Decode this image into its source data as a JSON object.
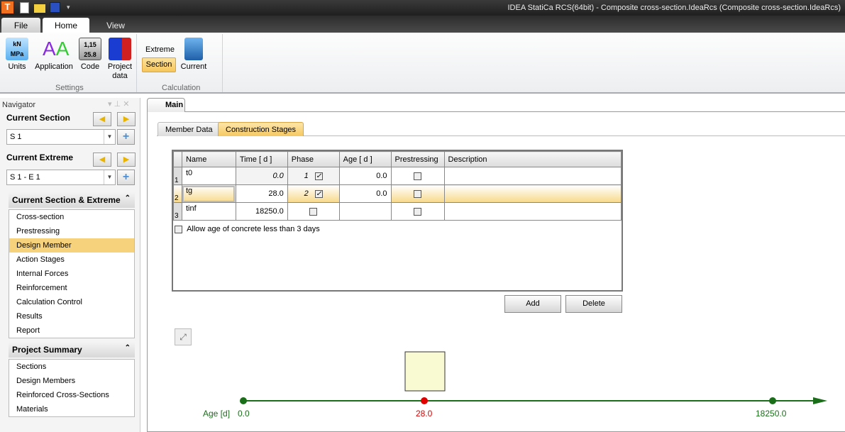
{
  "title": "IDEA StatiCa RCS(64bit) - Composite cross-section.IdeaRcs (Composite cross-section.IdeaRcs)",
  "ribbon_tabs": [
    "File",
    "Home",
    "View"
  ],
  "settings": {
    "group": "Settings",
    "buttons": [
      "Units",
      "Application",
      "Code",
      "Project data"
    ]
  },
  "calculation": {
    "group": "Calculation",
    "extreme": "Extreme",
    "section": "Section",
    "current": "Current"
  },
  "navigator": {
    "title": "Navigator",
    "current_section_label": "Current Section",
    "current_section": "S 1",
    "current_extreme_label": "Current Extreme",
    "current_extreme": "S 1 - E 1",
    "cse_header": "Current Section & Extreme",
    "cse_items": [
      "Cross-section",
      "Prestressing",
      "Design Member",
      "Action Stages",
      "Internal Forces",
      "Reinforcement",
      "Calculation Control",
      "Results",
      "Report"
    ],
    "ps_header": "Project Summary",
    "ps_items": [
      "Sections",
      "Design Members",
      "Reinforced Cross-Sections",
      "Materials"
    ]
  },
  "main_tab": "Main",
  "sub_tabs": [
    "Member Data",
    "Construction Stages"
  ],
  "table": {
    "headers": [
      "Name",
      "Time   [ d ]",
      "Phase",
      "Age   [ d ]",
      "Prestressing",
      "Description"
    ],
    "rows": [
      {
        "n": "1",
        "name": "t0",
        "time": "0.0",
        "phase": "1",
        "phase_checked": true,
        "age": "0.0",
        "prestressing": false,
        "desc": ""
      },
      {
        "n": "2",
        "name": "tg",
        "time": "28.0",
        "phase": "2",
        "phase_checked": true,
        "age": "0.0",
        "prestressing": false,
        "desc": ""
      },
      {
        "n": "3",
        "name": "tinf",
        "time": "18250.0",
        "phase": "",
        "phase_checked": false,
        "age": "",
        "prestressing": false,
        "desc": ""
      }
    ]
  },
  "allow_age_label": "Allow age of concrete less than 3 days",
  "allow_age_checked": false,
  "add_label": "Add",
  "delete_label": "Delete",
  "timeline": {
    "axis_label": "Age [d]",
    "points": [
      {
        "label": "0.0",
        "color": "#1a6e1a"
      },
      {
        "label": "28.0",
        "color": "#e00000"
      },
      {
        "label": "18250.0",
        "color": "#1a6e1a"
      }
    ]
  }
}
